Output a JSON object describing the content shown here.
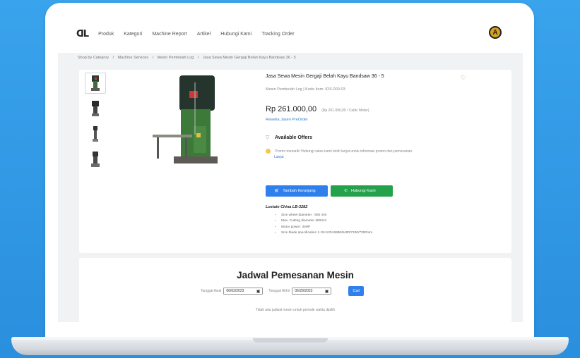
{
  "nav": {
    "logo": "ᗡL",
    "items": [
      "Produk",
      "Kategori",
      "Machine Report",
      "Artikel",
      "Hubungi Kami",
      "Tracking Order"
    ],
    "avatar_letter": "A"
  },
  "breadcrumb": [
    "Shop by Category",
    "/",
    "Machine Services",
    "/",
    "Mesin Pembelah Log",
    "/",
    "Jasa Sewa Mesin Gergaji Belah Kayu Bandsaw 36 - 5"
  ],
  "product": {
    "title": "Jasa Sewa Mesin Gergaji Belah Kayu Bandsaw 36 - 5",
    "subinfo": "Mesin Pembelah Log | Kode Item: IOS-000-03",
    "price": "Rp 261.000,00",
    "price_note": "(Rp 261.000,00 / Cubic Meter)",
    "preorder_link": "Rewelia Jasen PreOrder",
    "offers_title": "Available Offers",
    "promo_text": "Promo menarik! Hubungi sales kami lebih lanjut untuk informasi promo dan pemesanan.",
    "promo_link": "Lanjut",
    "cart_button": "Tambah Keranjang",
    "contact_button": "Hubungi Kami",
    "spec_title": "Loxtain China LB-3282",
    "specs": [
      "Size wheel diameter : 900 mm",
      "Max. Cutting diameter 450mm",
      "Motor power: 30HP",
      "Size blade specification 1.15×120×6850/6400/7100/7300mm"
    ]
  },
  "schedule": {
    "title": "Jadwal Pemesanan Mesin",
    "start_label": "Tanggal Awal",
    "start_value": "06/03/2023",
    "end_label": "Tanggal Akhir",
    "end_value": "06/29/2023",
    "find_button": "Cari",
    "empty_text": "Tidak ada jadwal mesin untuk periode waktu dipilih"
  },
  "colors": {
    "background": "#2f95e3",
    "primary": "#2f80ed",
    "success": "#23a14b",
    "link": "#2f7fd3"
  }
}
